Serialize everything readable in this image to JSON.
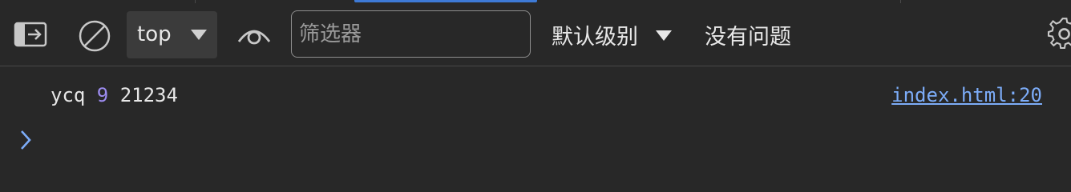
{
  "toolbar": {
    "sidebar_toggle_icon": "sidebar-toggle-icon",
    "clear_icon": "clear-console-icon",
    "context": "top",
    "live_expression_icon": "eye-icon",
    "filter_placeholder": "筛选器",
    "levels_label": "默认级别",
    "issues_label": "没有问题",
    "settings_icon": "gear-icon"
  },
  "console": {
    "messages": [
      {
        "prefix": "ycq ",
        "number": "9",
        "suffix": " 21234",
        "source": "index.html:20"
      }
    ],
    "prompt_icon": "chevron-right-icon"
  },
  "colors": {
    "background": "#282828",
    "accent": "#3e7ad6",
    "number": "#9d8cf0",
    "link": "#7cacf8"
  }
}
